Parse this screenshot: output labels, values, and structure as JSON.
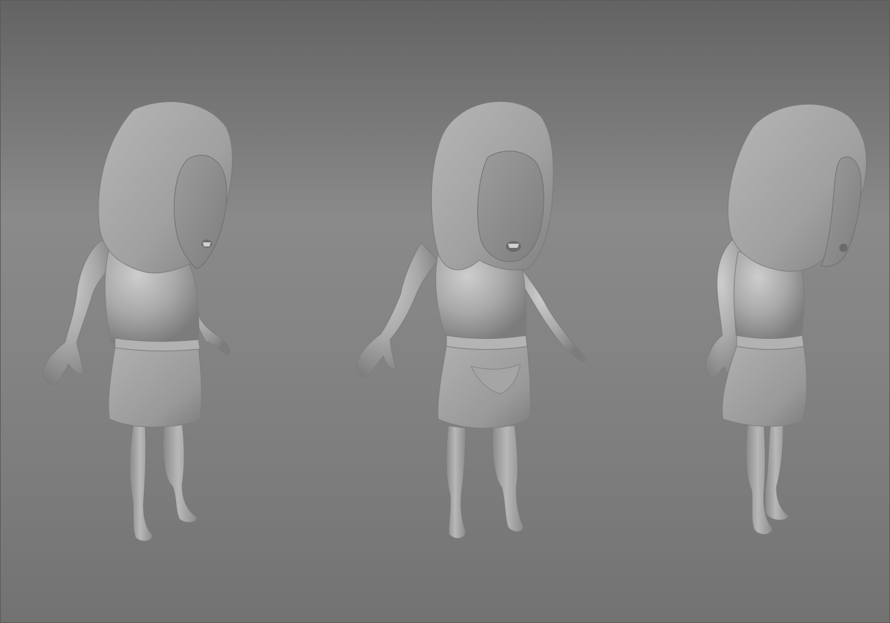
{
  "scene": {
    "background_top": "#636363",
    "background_bottom": "#727272",
    "clay_base": "#a9a9a9",
    "clay_light": "#c9c9c9",
    "clay_shadow": "#7a7a7a",
    "models": [
      {
        "view": "three-quarter-right"
      },
      {
        "view": "front"
      },
      {
        "view": "side-right"
      }
    ]
  }
}
